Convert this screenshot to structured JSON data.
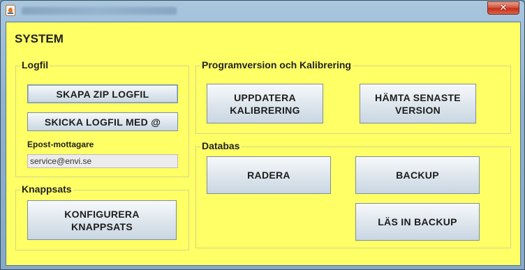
{
  "window": {
    "title": "",
    "close_glyph": "✕"
  },
  "panel": {
    "title": "SYSTEM"
  },
  "logfil": {
    "title": "Logfil",
    "zip_button": "SKAPA ZIP LOGFIL",
    "send_button": "SKICKA LOGFIL MED @",
    "email_label": "Epost-mottagare",
    "email_value": "service@envi.se"
  },
  "knappsats": {
    "title": "Knappsats",
    "configure_line1": "KONFIGURERA",
    "configure_line2": "KNAPPSATS"
  },
  "program": {
    "title": "Programversion och Kalibrering",
    "update_line1": "UPPDATERA",
    "update_line2": "KALIBRERING",
    "latest_line1": "HÄMTA SENASTE",
    "latest_line2": "VERSION"
  },
  "databas": {
    "title": "Databas",
    "delete_button": "RADERA",
    "backup_button": "BACKUP",
    "restore_button": "LÄS IN BACKUP"
  },
  "colors": {
    "panel_background": "#ffff66",
    "button_border": "#7d8e9d",
    "close_button": "#c3301b"
  }
}
